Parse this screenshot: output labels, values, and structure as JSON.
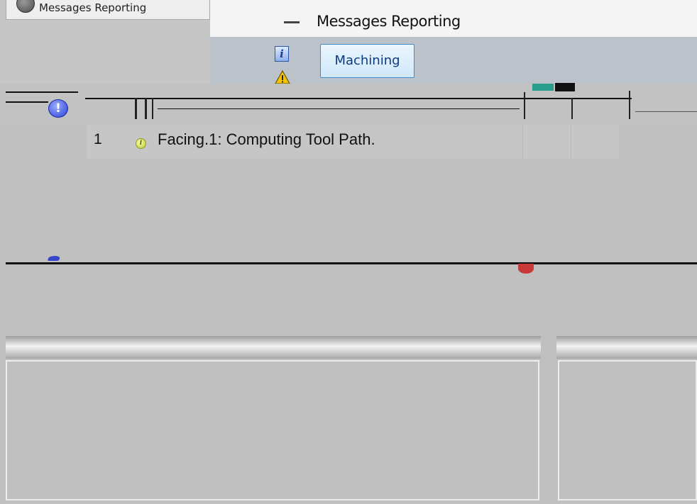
{
  "window": {
    "tab_title": "Messages Reporting",
    "title": "Messages Reporting",
    "minimize_symbol": "—"
  },
  "toolbar": {
    "info_icon": "i",
    "mode_button_label": "Machining"
  },
  "messages": [
    {
      "index": "1",
      "icon": "info-icon",
      "text": "Facing.1: Computing Tool Path."
    }
  ],
  "colors": {
    "accent_border": "#3c8ed0",
    "error_icon": "#2a3fd6",
    "info_icon": "#b6c82a"
  }
}
